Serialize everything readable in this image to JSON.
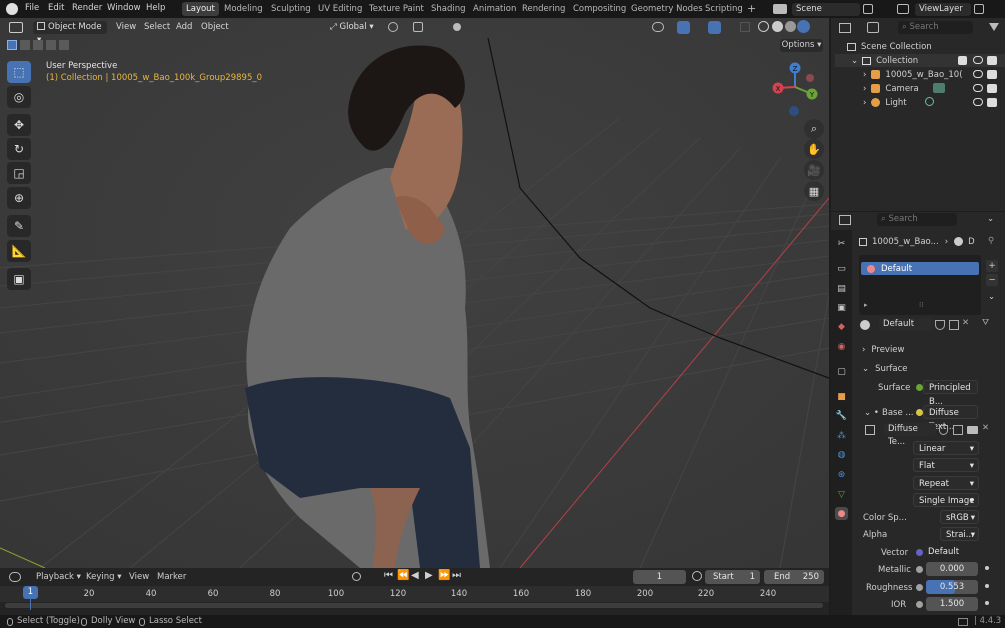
{
  "menubar": {
    "items": [
      "File",
      "Edit",
      "Render",
      "Window",
      "Help"
    ],
    "workspaces": [
      "Layout",
      "Modeling",
      "Sculpting",
      "UV Editing",
      "Texture Paint",
      "Shading",
      "Animation",
      "Rendering",
      "Compositing",
      "Geometry Nodes",
      "Scripting"
    ],
    "active_workspace": "Layout",
    "scene": "Scene",
    "view_layer": "ViewLayer",
    "add_tab": "+"
  },
  "viewport_header": {
    "mode": "Object Mode",
    "menus": [
      "View",
      "Select",
      "Add",
      "Object"
    ],
    "transform_orientation": "Global",
    "options": "Options"
  },
  "viewport": {
    "perspective_label": "User Perspective",
    "collection_label": "(1) Collection | 10005_w_Bao_100k_Group29895_0",
    "gizmo": {
      "x": "X",
      "y": "Y",
      "z": "Z"
    }
  },
  "outliner": {
    "search_placeholder": "Search",
    "root": "Scene Collection",
    "collection": "Collection",
    "items": [
      {
        "label": "10005_w_Bao_10("
      },
      {
        "label": "Camera"
      },
      {
        "label": "Light"
      }
    ]
  },
  "properties": {
    "search_placeholder": "Search",
    "breadcrumb_object": "10005_w_Bao...",
    "breadcrumb_material": "D",
    "slot_name": "Default",
    "material_name": "Default",
    "sections": {
      "preview": "Preview",
      "surface": "Surface"
    },
    "surface_label": "Surface",
    "surface_value": "Principled B...",
    "base_label": "Base ...",
    "base_value": "Diffuse Text...",
    "image_name": "Diffuse Te...",
    "interpolation": "Linear",
    "projection": "Flat",
    "extension": "Repeat",
    "source": "Single Image",
    "color_space_label": "Color Sp...",
    "color_space": "sRGB",
    "alpha_label": "Alpha",
    "alpha_value": "Strai...",
    "vector_label": "Vector",
    "vector_value": "Default",
    "metallic_label": "Metallic",
    "metallic": "0.000",
    "metallic_fraction": 0,
    "roughness_label": "Roughness",
    "roughness": "0.553",
    "roughness_fraction": 0.553,
    "ior_label": "IOR",
    "ior": "1.500"
  },
  "timeline": {
    "menus": [
      "Playback",
      "Keying",
      "View",
      "Marker"
    ],
    "current_frame": "1",
    "start_label": "Start",
    "start": "1",
    "end_label": "End",
    "end": "250",
    "ruler": [
      "1",
      "20",
      "40",
      "60",
      "80",
      "100",
      "120",
      "140",
      "160",
      "180",
      "200",
      "220",
      "240"
    ]
  },
  "status": {
    "select": "Select (Toggle)",
    "dolly": "Dolly View",
    "lasso": "Lasso Select",
    "version": "4.4.3"
  },
  "colors": {
    "accent": "#4772b3",
    "x_axis": "#d2434f",
    "y_axis": "#6aa337",
    "z_axis": "#3f7dd1",
    "bg": "#3b3b3b"
  }
}
